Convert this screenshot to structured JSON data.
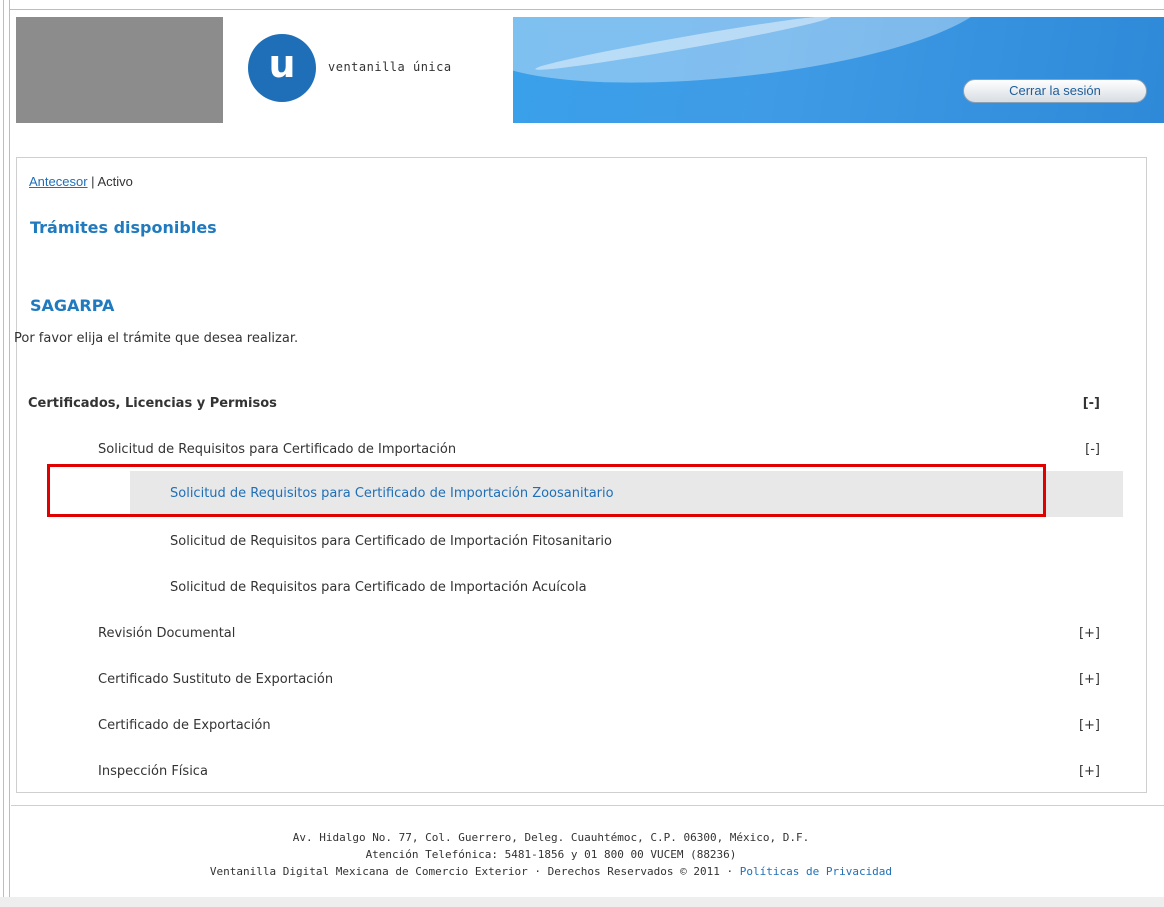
{
  "header": {
    "logo_letter": "u",
    "logo_text": "ventanilla única",
    "logout_label": "Cerrar la sesión"
  },
  "breadcrumb": {
    "link": "Antecesor",
    "separator": "|",
    "current": "Activo"
  },
  "section_title": "Trámites disponibles",
  "org_title": "SAGARPA",
  "instructions": "Por favor elija el trámite que desea realizar.",
  "tree": {
    "category": {
      "label": "Certificados, Licencias y Permisos",
      "toggle": "[-]"
    },
    "subitems": [
      {
        "label": "Solicitud de Requisitos para Certificado de Importación",
        "toggle": "[-]"
      },
      {
        "label": "Revisión Documental",
        "toggle": "[+]"
      },
      {
        "label": "Certificado Sustituto de Exportación",
        "toggle": "[+]"
      },
      {
        "label": "Certificado de Exportación",
        "toggle": "[+]"
      },
      {
        "label": "Inspección Física",
        "toggle": "[+]"
      }
    ],
    "leaves": [
      {
        "label": "Solicitud de Requisitos para Certificado de Importación Zoosanitario"
      },
      {
        "label": "Solicitud de Requisitos para Certificado de Importación Fitosanitario"
      },
      {
        "label": "Solicitud de Requisitos para Certificado de Importación Acuícola"
      }
    ]
  },
  "footer": {
    "line1": "Av. Hidalgo No. 77, Col. Guerrero, Deleg. Cuauhtémoc, C.P. 06300, México, D.F.",
    "line2": "Atención Telefónica: 5481-1856 y 01 800 00 VUCEM (88236)",
    "line3": "Ventanilla Digital Mexicana de Comercio Exterior · Derechos Reservados © 2011 ·",
    "privacy_link": "Políticas de Privacidad"
  },
  "colors": {
    "brand_blue": "#1f6fb8",
    "title_blue": "#1f7abf",
    "highlight_red": "#e00000"
  }
}
